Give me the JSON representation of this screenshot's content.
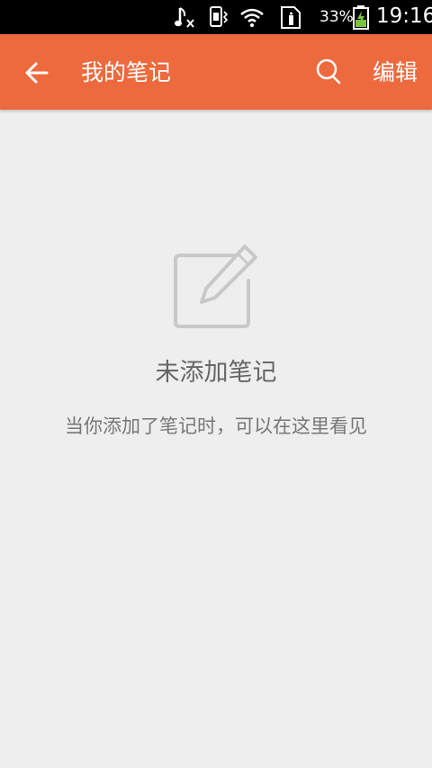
{
  "status_bar": {
    "battery_percent": "33%",
    "time": "19:16",
    "icons": [
      "music-note-icon",
      "phone-vibrate-icon",
      "wifi-icon",
      "sim-card-icon",
      "battery-charging-icon"
    ]
  },
  "app_bar": {
    "title": "我的笔记",
    "edit_label": "编辑",
    "background_color": "#ec6a3e"
  },
  "empty_state": {
    "title": "未添加笔记",
    "description": "当你添加了笔记时，可以在这里看见"
  }
}
